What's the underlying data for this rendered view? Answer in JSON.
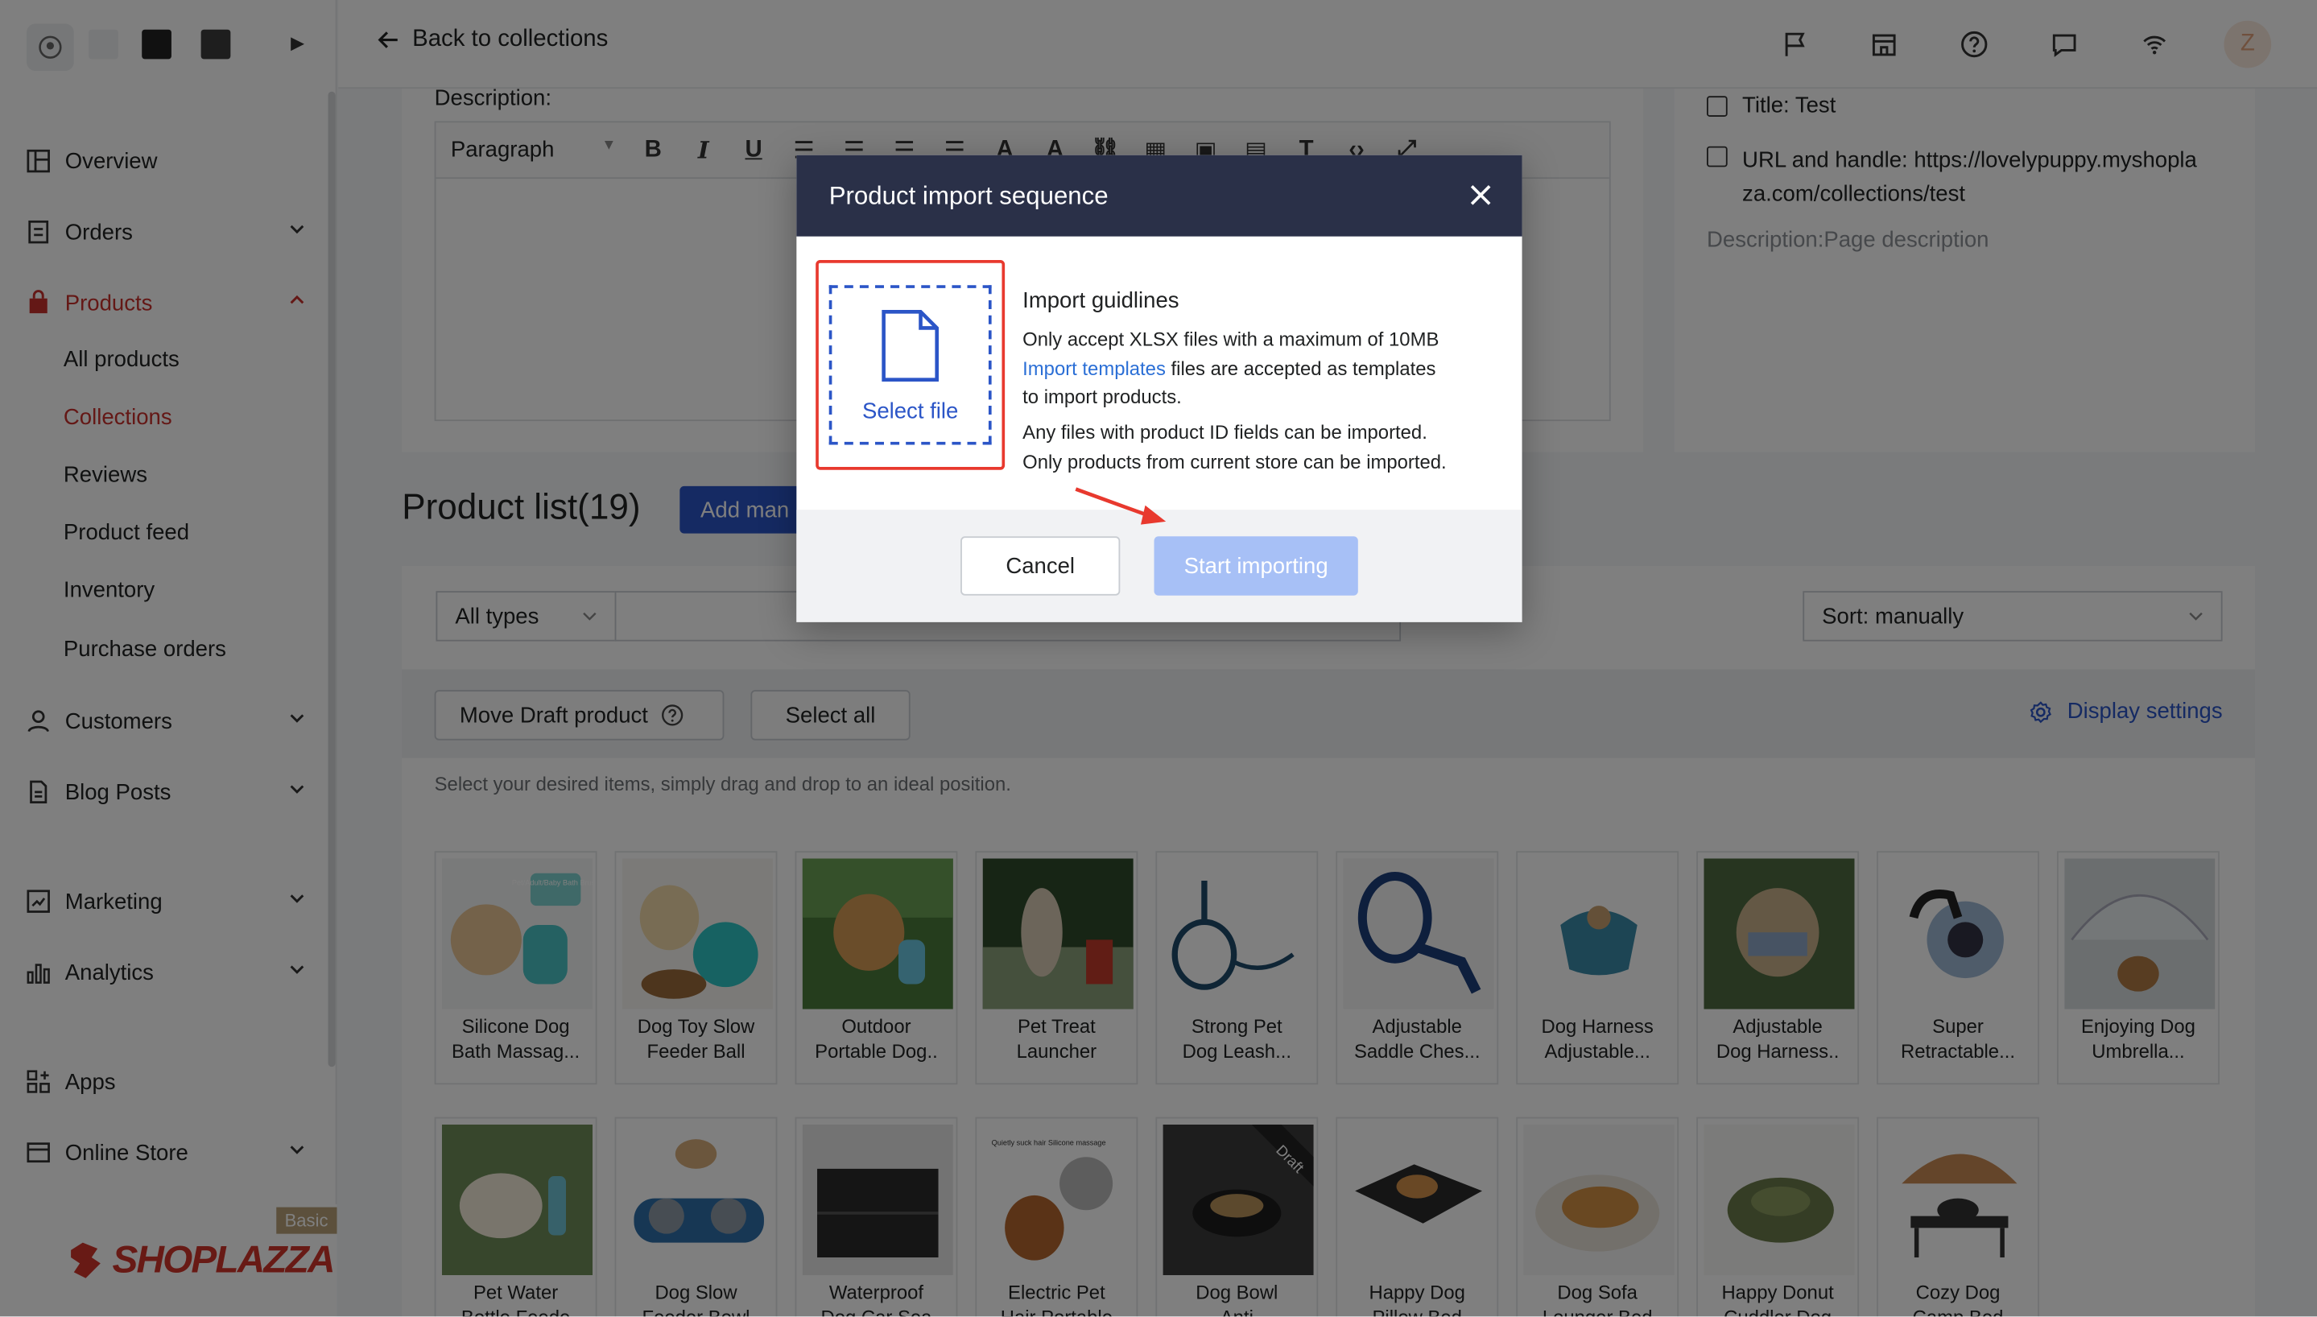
{
  "topbar": {
    "back_label": "Back to collections",
    "avatar_letter": "Z"
  },
  "sidebar": {
    "items": [
      {
        "label": "Overview",
        "icon": "overview-icon"
      },
      {
        "label": "Orders",
        "icon": "orders-icon"
      },
      {
        "label": "Products",
        "icon": "products-icon"
      },
      {
        "label": "Customers",
        "icon": "customers-icon"
      },
      {
        "label": "Blog Posts",
        "icon": "blog-icon"
      },
      {
        "label": "Marketing",
        "icon": "marketing-icon"
      },
      {
        "label": "Analytics",
        "icon": "analytics-icon"
      },
      {
        "label": "Apps",
        "icon": "apps-icon"
      },
      {
        "label": "Online Store",
        "icon": "store-icon"
      }
    ],
    "product_sub": [
      "All products",
      "Collections",
      "Reviews",
      "Product feed",
      "Inventory",
      "Purchase orders"
    ],
    "plan_badge": "Basic",
    "brand_name": "SHOPLAZZA"
  },
  "editor": {
    "description_label": "Description:",
    "paragraph_label": "Paragraph"
  },
  "side_panel": {
    "title": "Title: Test",
    "url_line1": "URL and handle: https://lovelypuppy.myshopla",
    "url_line2": "za.com/collections/test",
    "description": "Description:Page description"
  },
  "product_list": {
    "title": "Product list(19)",
    "add_manual_label": "Add man",
    "type_filter": "All types",
    "sort": "Sort: manually",
    "move_draft_label": "Move Draft product",
    "select_all_label": "Select all",
    "display_settings_label": "Display settings",
    "hint": "Select your desired items, simply drag and drop to an ideal position.",
    "products": [
      {
        "name_1": "Silicone Dog",
        "name_2": "Bath Massag..."
      },
      {
        "name_1": "Dog Toy Slow",
        "name_2": "Feeder Ball"
      },
      {
        "name_1": "Outdoor",
        "name_2": "Portable Dog.."
      },
      {
        "name_1": "Pet Treat",
        "name_2": "Launcher"
      },
      {
        "name_1": "Strong Pet",
        "name_2": "Dog Leash..."
      },
      {
        "name_1": "Adjustable",
        "name_2": "Saddle Ches..."
      },
      {
        "name_1": "Dog Harness",
        "name_2": "Adjustable..."
      },
      {
        "name_1": "Adjustable",
        "name_2": "Dog Harness.."
      },
      {
        "name_1": "Super",
        "name_2": "Retractable..."
      },
      {
        "name_1": "Enjoying Dog",
        "name_2": "Umbrella..."
      },
      {
        "name_1": "Pet Water",
        "name_2": "Bottle Feede"
      },
      {
        "name_1": "Dog Slow",
        "name_2": "Feeder Bowl"
      },
      {
        "name_1": "Waterproof",
        "name_2": "Dog Car Sea"
      },
      {
        "name_1": "Electric Pet",
        "name_2": "Hair Portable"
      },
      {
        "name_1": "Dog Bowl",
        "name_2": "Anti"
      },
      {
        "name_1": "Happy Dog",
        "name_2": "Pillow Bed"
      },
      {
        "name_1": "Dog Sofa",
        "name_2": "Lounger Bed"
      },
      {
        "name_1": "Happy Donut",
        "name_2": "Cuddler Dog"
      },
      {
        "name_1": "Cozy Dog",
        "name_2": "Camp Bed"
      }
    ],
    "draft_badge": "Draft",
    "product_image_texts": {
      "bath_brush": "Pet/Adult/Baby Bath Brush",
      "hair_remover": "Quietly suck hair Silicone massage"
    }
  },
  "modal": {
    "title": "Product import sequence",
    "select_file_label": "Select file",
    "guide_title": "Import guidlines",
    "line1": "Only accept XLSX files with a maximum of 10MB",
    "link": "Import templates",
    "line2_rest": " files are accepted as templates",
    "line3": "to import products.",
    "line4": "Any files with product ID fields can be imported.",
    "line5": "Only products from current store can be imported.",
    "cancel_label": "Cancel",
    "start_label": "Start importing"
  },
  "colors": {
    "accent": "#2b55c7",
    "active_nav": "#c9302c",
    "modal_header": "#2a3048",
    "highlight": "#e8392e",
    "disabled_primary": "#a7c0f6"
  }
}
